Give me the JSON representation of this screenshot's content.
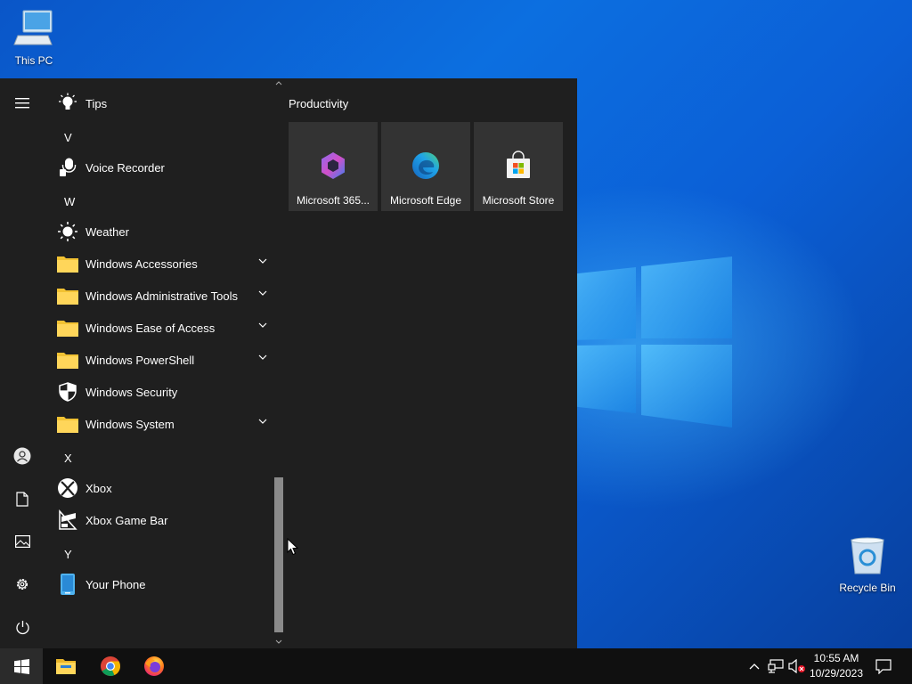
{
  "desktop": {
    "icons": [
      {
        "label": "This PC",
        "icon": "computer-icon"
      },
      {
        "label": "Recycle Bin",
        "icon": "recycle-bin-icon"
      }
    ]
  },
  "start_menu": {
    "rail": [
      {
        "icon": "hamburger-menu-icon"
      },
      {
        "icon": "user-account-icon"
      },
      {
        "icon": "documents-icon"
      },
      {
        "icon": "pictures-icon"
      },
      {
        "icon": "settings-gear-icon"
      },
      {
        "icon": "power-icon"
      }
    ],
    "app_list": [
      {
        "type": "app",
        "label": "Tips",
        "icon": "lightbulb-icon"
      },
      {
        "type": "letter",
        "label": "V"
      },
      {
        "type": "app",
        "label": "Voice Recorder",
        "icon": "microphone-icon"
      },
      {
        "type": "letter",
        "label": "W"
      },
      {
        "type": "app",
        "label": "Weather",
        "icon": "sun-icon"
      },
      {
        "type": "folder",
        "label": "Windows Accessories",
        "icon": "folder-icon"
      },
      {
        "type": "folder",
        "label": "Windows Administrative Tools",
        "icon": "folder-icon"
      },
      {
        "type": "folder",
        "label": "Windows Ease of Access",
        "icon": "folder-icon"
      },
      {
        "type": "folder",
        "label": "Windows PowerShell",
        "icon": "folder-icon"
      },
      {
        "type": "app",
        "label": "Windows Security",
        "icon": "shield-icon"
      },
      {
        "type": "folder",
        "label": "Windows System",
        "icon": "folder-icon"
      },
      {
        "type": "letter",
        "label": "X"
      },
      {
        "type": "app",
        "label": "Xbox",
        "icon": "xbox-icon"
      },
      {
        "type": "app",
        "label": "Xbox Game Bar",
        "icon": "xbox-game-bar-icon"
      },
      {
        "type": "letter",
        "label": "Y"
      },
      {
        "type": "app",
        "label": "Your Phone",
        "icon": "phone-icon"
      }
    ],
    "tile_group": {
      "title": "Productivity",
      "tiles": [
        {
          "label": "Microsoft 365...",
          "icon": "microsoft-365-icon"
        },
        {
          "label": "Microsoft Edge",
          "icon": "edge-icon"
        },
        {
          "label": "Microsoft Store",
          "icon": "store-icon"
        }
      ]
    }
  },
  "taskbar": {
    "start_icon": "windows-start-icon",
    "pinned": [
      {
        "icon": "file-explorer-icon"
      },
      {
        "icon": "chrome-icon"
      },
      {
        "icon": "firefox-icon"
      }
    ],
    "tray": {
      "icons": [
        "show-hidden-icons-chevron-icon",
        "network-icon",
        "volume-muted-icon"
      ],
      "time": "10:55 AM",
      "date": "10/29/2023",
      "notification_icon": "action-center-icon"
    }
  }
}
